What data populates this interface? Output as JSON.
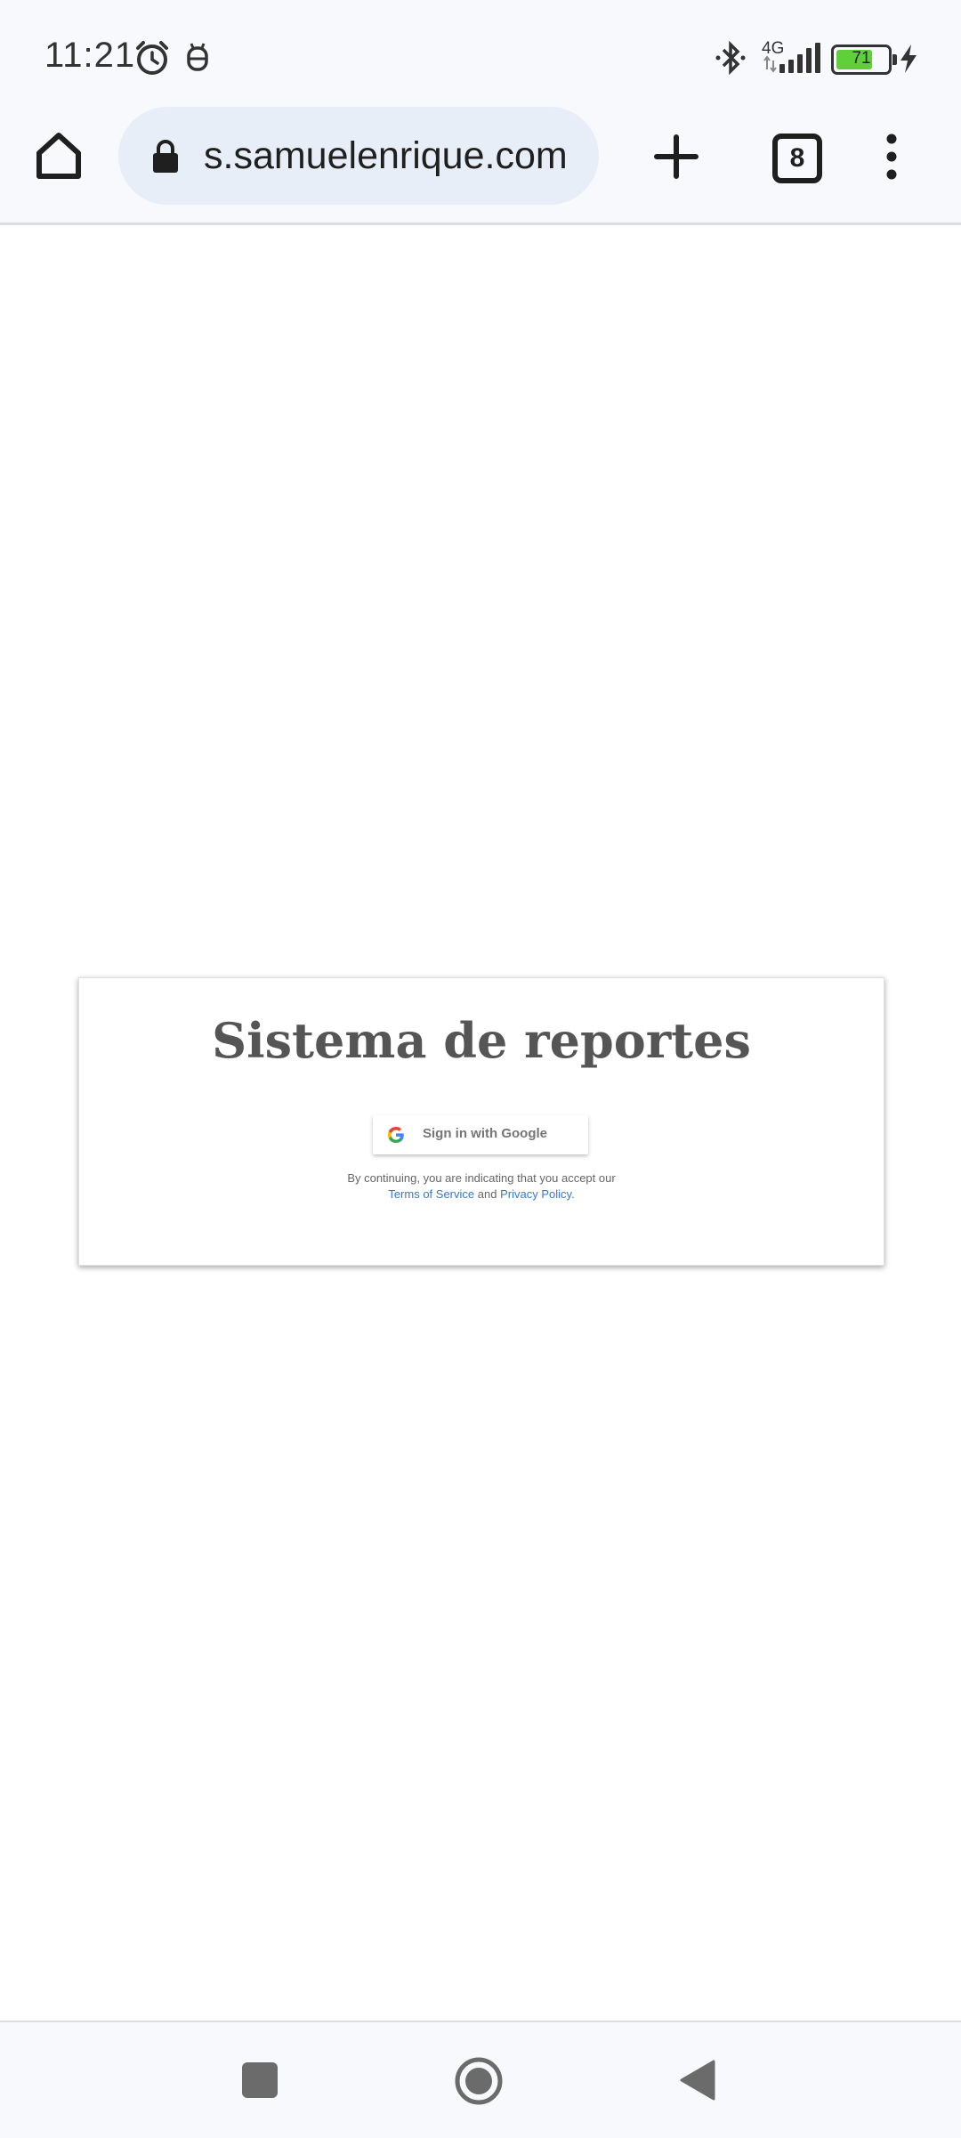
{
  "status_bar": {
    "time": "11:21",
    "network": "4G",
    "battery": "71",
    "icons": [
      "alarm-icon",
      "bug-icon",
      "bluetooth-icon",
      "signal-icon",
      "battery-icon",
      "charging-icon"
    ]
  },
  "browser": {
    "url": "s.samuelenrique.com",
    "tab_count": "8",
    "icons": [
      "home-icon",
      "lock-icon",
      "plus-icon",
      "tabs-icon",
      "menu-icon"
    ]
  },
  "card": {
    "title": "Sistema de reportes",
    "google_button_label": "Sign in with Google",
    "legal_prefix": "By continuing, you are indicating that you accept our",
    "terms_link": "Terms of Service",
    "legal_and": "and",
    "privacy_link": "Privacy Policy",
    "legal_suffix": "."
  },
  "nav_bar": {
    "icons": [
      "recents-icon",
      "home-circle-icon",
      "back-icon"
    ]
  },
  "colors": {
    "chrome_bg": "#f8f9fc",
    "url_pill_bg": "#e8eef7",
    "link_blue": "#3b78c4",
    "title_gray": "#555555",
    "battery_green": "#5fd03a"
  }
}
